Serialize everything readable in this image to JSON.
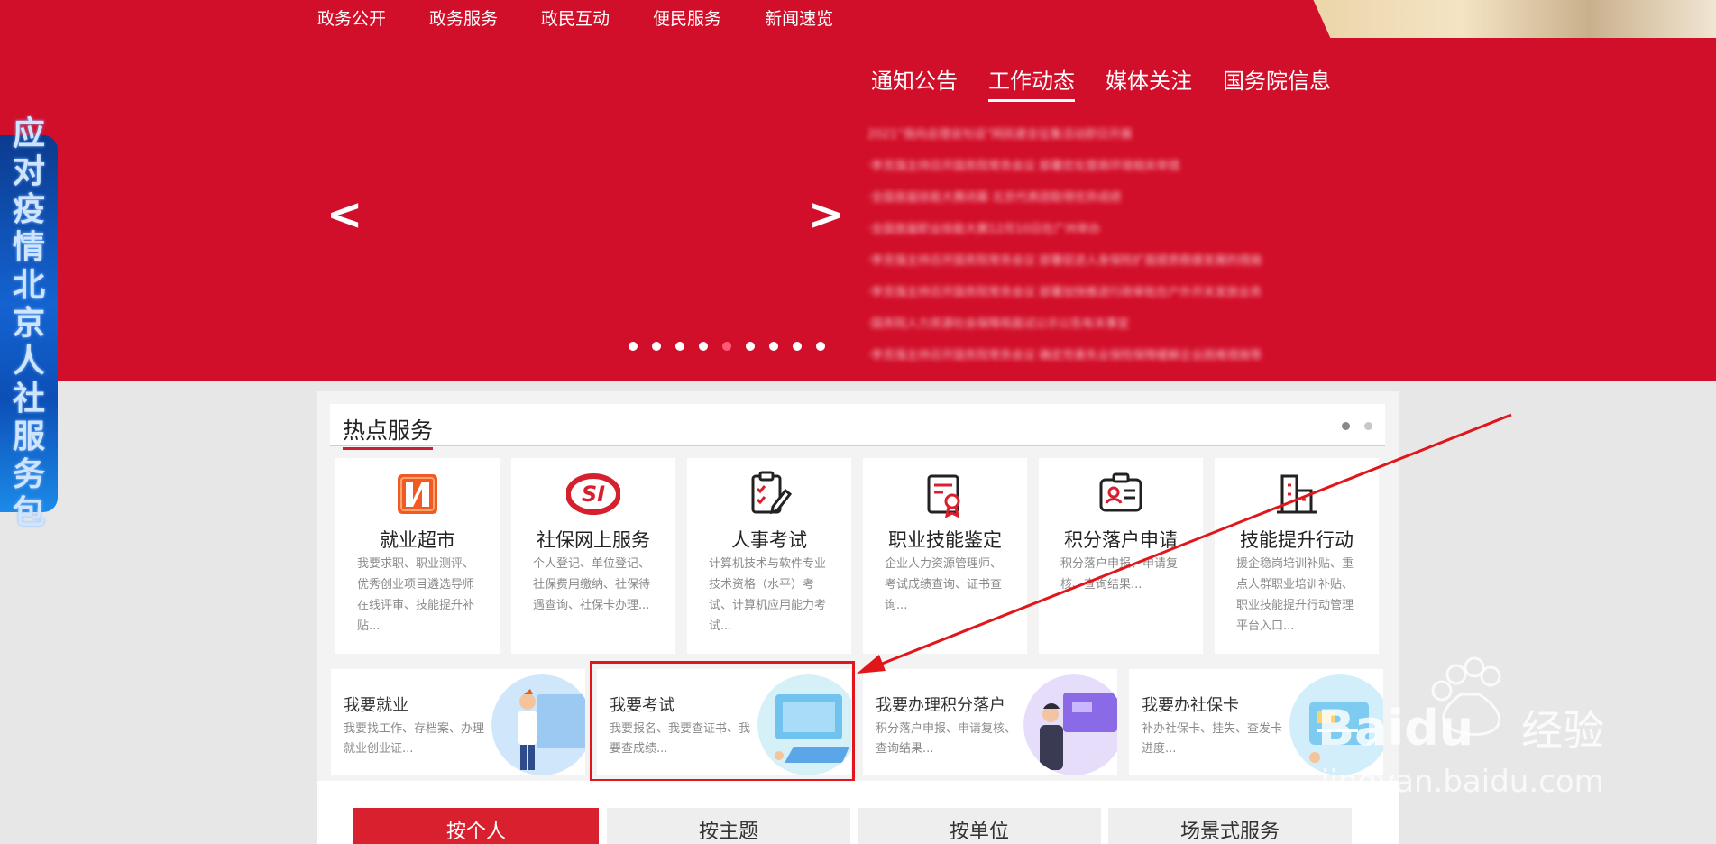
{
  "top_nav": [
    "政务公开",
    "政务服务",
    "政民互动",
    "便民服务",
    "新闻速览"
  ],
  "side_badge": {
    "chars": [
      "应",
      "对",
      "疫",
      "情",
      "北",
      "京",
      "人",
      "社",
      "服",
      "务",
      "包"
    ]
  },
  "carousel": {
    "prev": "<",
    "next": ">",
    "dot_count": 9,
    "active_dot": 5
  },
  "news_tabs": [
    {
      "label": "通知公告",
      "active": false
    },
    {
      "label": "工作动态",
      "active": true
    },
    {
      "label": "媒体关注",
      "active": false
    },
    {
      "label": "国务院信息",
      "active": false
    }
  ],
  "news_items": [
    "2021“我向总理说句话”网民建言征集活动即日开展",
    "·李克强主持召开国务院常务会议 部署优化营商环境相关举措",
    "·全国首届技能大赛闭幕 北京代表团取得优异成绩",
    "·全国首届职业技能大赛12月10日在广州举办",
    "·李克强主持召开国务院常务会议 部署促进人身保险扩面提质稳健发展的措施",
    "·李克强主持召开国务院常务会议 部署加快推进行政审批在户外开关发放业务",
    "·国务院人力资源社会保障局面试公示公告有关事宜",
    "·李克强主持召开国务院常务会议 确定完善失业保险保障缓解企业困难措施等"
  ],
  "hot_services": {
    "title": "热点服务",
    "cards": [
      {
        "title": "就业超市",
        "desc": "我要求职、职业测评、优秀创业项目遴选导师在线评审、技能提升补贴..."
      },
      {
        "title": "社保网上服务",
        "desc": "个人登记、单位登记、社保费用缴纳、社保待遇查询、社保卡办理..."
      },
      {
        "title": "人事考试",
        "desc": "计算机技术与软件专业技术资格（水平）考试、计算机应用能力考试..."
      },
      {
        "title": "职业技能鉴定",
        "desc": "企业人力资源管理师、考试成绩查询、证书查询..."
      },
      {
        "title": "积分落户申请",
        "desc": "积分落户申报、申请复核、查询结果..."
      },
      {
        "title": "技能提升行动",
        "desc": "援企稳岗培训补贴、重点人群职业培训补贴、职业技能提升行动管理平台入口..."
      }
    ]
  },
  "quick_links": [
    {
      "title": "我要就业",
      "desc": "我要找工作、存档案、办理就业创业证..."
    },
    {
      "title": "我要考试",
      "desc": "我要报名、我要查证书、我要查成绩..."
    },
    {
      "title": "我要办理积分落户",
      "desc": "积分落户申报、申请复核、查询结果..."
    },
    {
      "title": "我要办社保卡",
      "desc": "补办社保卡、挂失、查发卡进度..."
    }
  ],
  "bottom_tabs": [
    {
      "label": "按个人",
      "active": true
    },
    {
      "label": "按主题",
      "active": false
    },
    {
      "label": "按单位",
      "active": false
    },
    {
      "label": "场景式服务",
      "active": false
    }
  ],
  "watermark": {
    "brand": "Baidu",
    "cn": "经验",
    "url": "jingyan.baidu.com"
  },
  "colors": {
    "primary_red": "#d20f2a",
    "accent_red": "#e0161b",
    "active_tab": "#d9202e"
  }
}
